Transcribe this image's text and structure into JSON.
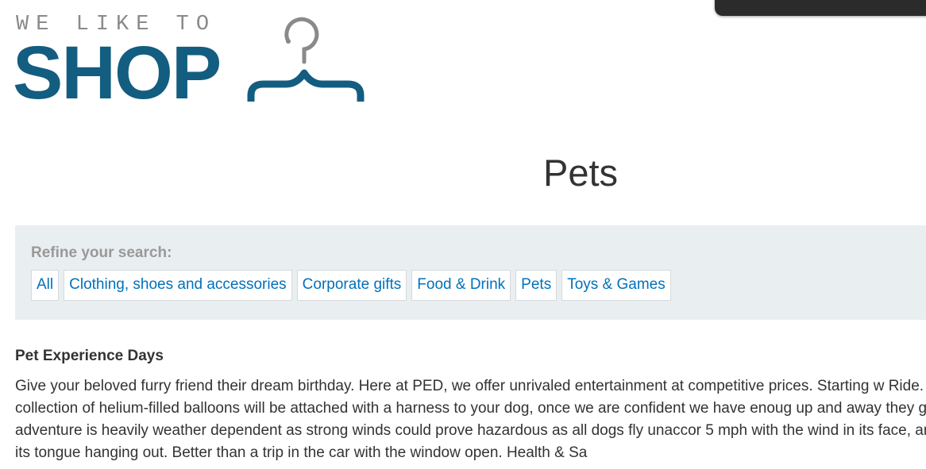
{
  "header": {
    "logo_tagline": "WE LIKE TO",
    "logo_word": "SHOP",
    "logo_icon": "hanger-icon",
    "brand_color": "#135d80"
  },
  "page": {
    "title": "Pets"
  },
  "filters": {
    "label": "Refine your search:",
    "items": [
      {
        "label": "All"
      },
      {
        "label": "Clothing, shoes and accessories"
      },
      {
        "label": "Corporate gifts"
      },
      {
        "label": "Food & Drink"
      },
      {
        "label": "Pets"
      },
      {
        "label": "Toys & Games"
      }
    ],
    "link_color": "#0071bc",
    "background_color": "#e9eef0"
  },
  "product": {
    "title": "Pet Experience Days",
    "description": "Give your beloved furry friend their dream birthday. Here at PED, we offer unrivaled entertainment at competitive prices. Starting w Ride. A large collection of helium-filled balloons will be attached with a harness to your dog, once we are confident we have enoug up and away they go. This adventure is heavily weather dependent as strong winds could prove hazardous as all dogs fly unaccor 5 mph with the wind in its face, and I expect its tongue hanging out. Better than a trip in the car with the window open. Health & Sa"
  }
}
